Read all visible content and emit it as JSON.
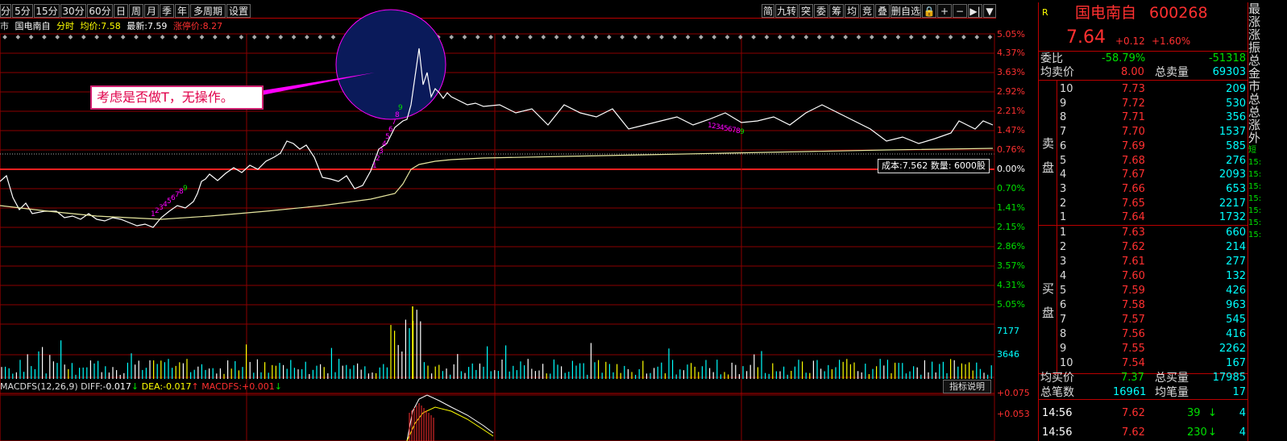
{
  "toolbar": {
    "left_items": [
      "分",
      "5分",
      "15分",
      "30分",
      "60分",
      "日",
      "周",
      "月",
      "季",
      "年",
      "多周期",
      "设置"
    ],
    "right_items": [
      "简",
      "九转",
      "突",
      "委",
      "筹",
      "均",
      "竞",
      "叠",
      "删自选",
      "🔒",
      "+",
      "−",
      "▶|",
      "▼"
    ]
  },
  "infobar": {
    "market": "市",
    "stock_name": "国电南自",
    "mode": "分时",
    "avg_label": "均价:",
    "avg_value": "7.58",
    "latest_label": "最新:",
    "latest_value": "7.59",
    "limit_label": "涨停价:",
    "limit_value": "8.27"
  },
  "annotation": "考虑是否做T，无操作。",
  "cost_box": {
    "cost_label": "成本:",
    "cost_value": "7.562",
    "qty_label": "数量:",
    "qty_value": "6000股"
  },
  "price_axis_right": [
    "5.05%",
    "4.37%",
    "3.63%",
    "2.92%",
    "2.21%",
    "1.47%",
    "0.76%",
    "0.00%",
    "0.70%",
    "1.41%",
    "2.15%",
    "2.86%",
    "3.57%",
    "4.31%",
    "5.05%"
  ],
  "volume_axis_right": [
    "7177",
    "3646"
  ],
  "macd": {
    "title": "MACDFS(12,26,9)",
    "diff_label": "DIFF:",
    "diff_value": "-0.017",
    "dea_label": "DEA:",
    "dea_value": "-0.017",
    "macdfs_label": "MACDFS:",
    "macdfs_value": "+0.001",
    "axis": [
      "+0.075",
      "+0.053"
    ],
    "indicator_button": "指标说明"
  },
  "quote": {
    "r_label": "R",
    "name": "国电南自",
    "code": "600268",
    "price": "7.64",
    "change": "+0.12",
    "change_pct": "+1.60%",
    "weibi_label": "委比",
    "weibi_value": "-58.79%",
    "weicha_value": "-51318",
    "sell_avg_label": "均卖价",
    "sell_avg_value": "8.00",
    "sell_total_label": "总卖量",
    "sell_total_value": "69303",
    "sell_side_label": [
      "卖",
      "盘"
    ],
    "asks": [
      {
        "level": "10",
        "price": "7.73",
        "vol": "209"
      },
      {
        "level": "9",
        "price": "7.72",
        "vol": "530"
      },
      {
        "level": "8",
        "price": "7.71",
        "vol": "356"
      },
      {
        "level": "7",
        "price": "7.70",
        "vol": "1537"
      },
      {
        "level": "6",
        "price": "7.69",
        "vol": "585"
      },
      {
        "level": "5",
        "price": "7.68",
        "vol": "276"
      },
      {
        "level": "4",
        "price": "7.67",
        "vol": "2093"
      },
      {
        "level": "3",
        "price": "7.66",
        "vol": "653"
      },
      {
        "level": "2",
        "price": "7.65",
        "vol": "2217"
      },
      {
        "level": "1",
        "price": "7.64",
        "vol": "1732"
      }
    ],
    "buy_side_label": [
      "买",
      "盘"
    ],
    "bids": [
      {
        "level": "1",
        "price": "7.63",
        "vol": "660"
      },
      {
        "level": "2",
        "price": "7.62",
        "vol": "214"
      },
      {
        "level": "3",
        "price": "7.61",
        "vol": "277"
      },
      {
        "level": "4",
        "price": "7.60",
        "vol": "132"
      },
      {
        "level": "5",
        "price": "7.59",
        "vol": "426"
      },
      {
        "level": "6",
        "price": "7.58",
        "vol": "963"
      },
      {
        "level": "7",
        "price": "7.57",
        "vol": "545"
      },
      {
        "level": "8",
        "price": "7.56",
        "vol": "416"
      },
      {
        "level": "9",
        "price": "7.55",
        "vol": "2262"
      },
      {
        "level": "10",
        "price": "7.54",
        "vol": "167"
      }
    ],
    "buy_avg_label": "均买价",
    "buy_avg_value": "7.37",
    "buy_total_label": "总买量",
    "buy_total_value": "17985",
    "trades_label": "总笔数",
    "trades_value": "16961",
    "per_trade_label": "均笔量",
    "per_trade_value": "17",
    "ticks": [
      {
        "time": "14:56",
        "price": "7.62",
        "vol": "39",
        "arrow": "↓",
        "num": "4"
      },
      {
        "time": "14:56",
        "price": "7.62",
        "vol": "230",
        "arrow": "↓",
        "num": "4"
      }
    ]
  },
  "side_column": [
    "最",
    "涨",
    "涨",
    "振",
    "总",
    "金",
    "市",
    "总",
    "总",
    "涨",
    "外",
    "短",
    "15:",
    "15:",
    "15:",
    "15:",
    "15:",
    "15:",
    "15:"
  ],
  "colors": {
    "red": "#ff3030",
    "green": "#00e000",
    "cyan": "#00ffff",
    "yellow": "#ffff00",
    "grid": "#8b0000",
    "white": "#ffffff",
    "magenta": "#ff00ff"
  },
  "tick_sequences": {
    "s1": [
      "1",
      "2",
      "3",
      "4",
      "5",
      "6",
      "7",
      "8",
      "9"
    ],
    "s2": [
      "1",
      "2",
      "3",
      "4",
      "5",
      "6",
      "7",
      "8",
      "9"
    ],
    "s3": [
      "1",
      "2",
      "3",
      "4",
      "5",
      "6",
      "7",
      "8",
      "9"
    ]
  }
}
